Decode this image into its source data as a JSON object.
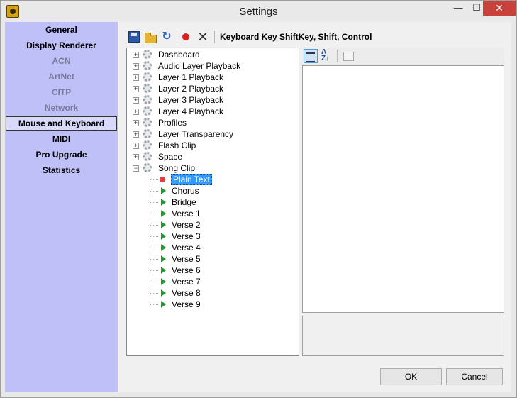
{
  "window": {
    "title": "Settings",
    "minimize_glyph": "—",
    "maximize_glyph": "☐",
    "close_glyph": "✕"
  },
  "sidebar": {
    "items": [
      {
        "label": "General",
        "state": "normal"
      },
      {
        "label": "Display Renderer",
        "state": "normal"
      },
      {
        "label": "ACN",
        "state": "disabled"
      },
      {
        "label": "ArtNet",
        "state": "disabled"
      },
      {
        "label": "CITP",
        "state": "disabled"
      },
      {
        "label": "Network",
        "state": "disabled"
      },
      {
        "label": "Mouse and Keyboard",
        "state": "selected"
      },
      {
        "label": "MIDI",
        "state": "normal"
      },
      {
        "label": "Pro Upgrade",
        "state": "normal"
      },
      {
        "label": "Statistics",
        "state": "normal"
      }
    ]
  },
  "toolbar": {
    "icons": [
      "save-icon",
      "open-folder-icon",
      "refresh-icon",
      "record-icon",
      "delete-icon"
    ],
    "refresh_glyph": "↻",
    "delete_glyph": "✕",
    "binding_label": "Keyboard Key ShiftKey, Shift, Control"
  },
  "tree": {
    "nodes": [
      {
        "label": "Dashboard",
        "expanded": false
      },
      {
        "label": "Audio Layer Playback",
        "expanded": false
      },
      {
        "label": "Layer 1 Playback",
        "expanded": false
      },
      {
        "label": "Layer 2 Playback",
        "expanded": false
      },
      {
        "label": "Layer 3 Playback",
        "expanded": false
      },
      {
        "label": "Layer 4 Playback",
        "expanded": false
      },
      {
        "label": "Profiles",
        "expanded": false
      },
      {
        "label": "Layer Transparency",
        "expanded": false
      },
      {
        "label": "Flash Clip",
        "expanded": false
      },
      {
        "label": "Space",
        "expanded": false
      },
      {
        "label": "Song Clip",
        "expanded": true
      }
    ],
    "expand_glyph": "+",
    "collapse_glyph": "−",
    "children": [
      {
        "label": "Plain Text",
        "icon": "record-dot-icon",
        "selected": true
      },
      {
        "label": "Chorus",
        "icon": "play-icon"
      },
      {
        "label": "Bridge",
        "icon": "play-icon"
      },
      {
        "label": "Verse 1",
        "icon": "play-icon"
      },
      {
        "label": "Verse 2",
        "icon": "play-icon"
      },
      {
        "label": "Verse 3",
        "icon": "play-icon"
      },
      {
        "label": "Verse 4",
        "icon": "play-icon"
      },
      {
        "label": "Verse 5",
        "icon": "play-icon"
      },
      {
        "label": "Verse 6",
        "icon": "play-icon"
      },
      {
        "label": "Verse 7",
        "icon": "play-icon"
      },
      {
        "label": "Verse 8",
        "icon": "play-icon"
      },
      {
        "label": "Verse 9",
        "icon": "play-icon"
      }
    ]
  },
  "properties": {
    "toolbar_icons": [
      "categorized-icon",
      "alphabetical-icon",
      "property-pages-icon"
    ],
    "alpha_glyph": "A Z↓"
  },
  "buttons": {
    "ok": "OK",
    "cancel": "Cancel"
  },
  "colors": {
    "sidebar_bg": "#c0c0f8",
    "selection": "#3399ff",
    "close_button": "#c7423a"
  }
}
